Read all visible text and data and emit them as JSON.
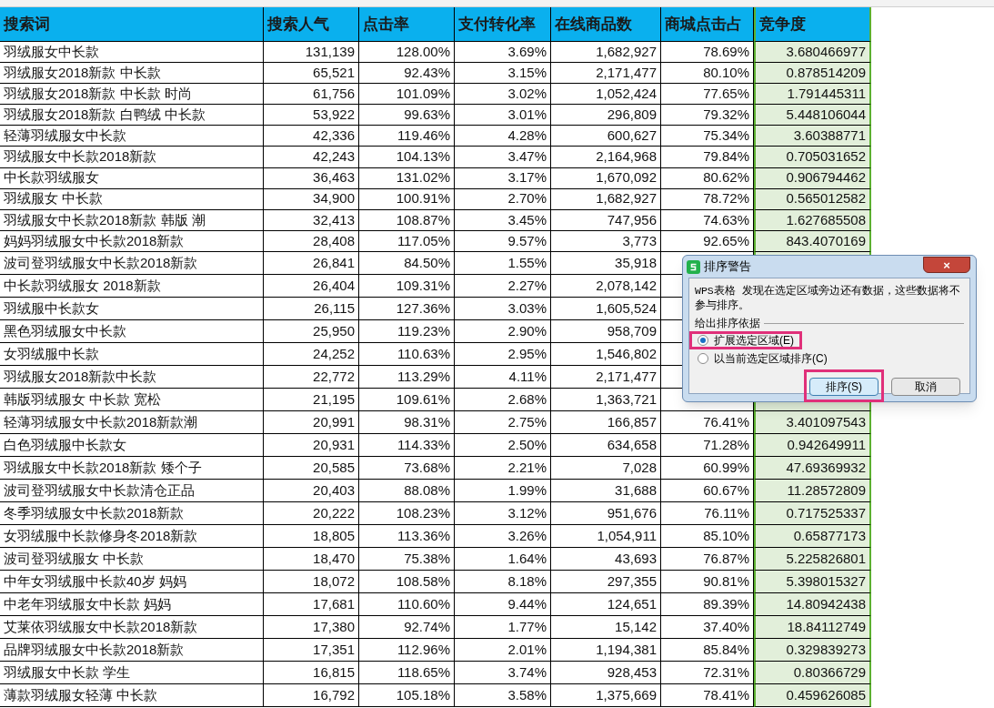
{
  "sheet": {
    "columns": [
      "搜索词",
      "搜索人气",
      "点击率",
      "支付转化率",
      "在线商品数",
      "商城点击占",
      "竞争度"
    ],
    "rows": [
      [
        "羽绒服女中长款",
        "131,139",
        "128.00%",
        "3.69%",
        "1,682,927",
        "78.69%",
        "3.680466977"
      ],
      [
        "羽绒服女2018新款 中长款",
        "65,521",
        "92.43%",
        "3.15%",
        "2,171,477",
        "80.10%",
        "0.878514209"
      ],
      [
        "羽绒服女2018新款 中长款 时尚",
        "61,756",
        "101.09%",
        "3.02%",
        "1,052,424",
        "77.65%",
        "1.791445311"
      ],
      [
        "羽绒服女2018新款 白鸭绒 中长款",
        "53,922",
        "99.63%",
        "3.01%",
        "296,809",
        "79.32%",
        "5.448106044"
      ],
      [
        "轻薄羽绒服女中长款",
        "42,336",
        "119.46%",
        "4.28%",
        "600,627",
        "75.34%",
        "3.60388771"
      ],
      [
        "羽绒服女中长款2018新款",
        "42,243",
        "104.13%",
        "3.47%",
        "2,164,968",
        "79.84%",
        "0.705031652"
      ],
      [
        "中长款羽绒服女",
        "36,463",
        "131.02%",
        "3.17%",
        "1,670,092",
        "80.62%",
        "0.906794462"
      ],
      [
        "羽绒服女 中长款",
        "34,900",
        "100.91%",
        "2.70%",
        "1,682,927",
        "78.72%",
        "0.565012582"
      ],
      [
        "羽绒服女中长款2018新款 韩版 潮",
        "32,413",
        "108.87%",
        "3.45%",
        "747,956",
        "74.63%",
        "1.627685508"
      ],
      [
        "妈妈羽绒服女中长款2018新款",
        "28,408",
        "117.05%",
        "9.57%",
        "3,773",
        "92.65%",
        "843.4070169"
      ],
      [
        "波司登羽绒服女中长款2018新款",
        "26,841",
        "84.50%",
        "1.55%",
        "35,918"
      ],
      [
        "中长款羽绒服女 2018新款",
        "26,404",
        "109.31%",
        "2.27%",
        "2,078,142"
      ],
      [
        "羽绒服中长款女",
        "26,115",
        "127.36%",
        "3.03%",
        "1,605,524"
      ],
      [
        "黑色羽绒服女中长款",
        "25,950",
        "119.23%",
        "2.90%",
        "958,709"
      ],
      [
        "女羽绒服中长款",
        "24,252",
        "110.63%",
        "2.95%",
        "1,546,802"
      ],
      [
        "羽绒服女2018新款中长款",
        "22,772",
        "113.29%",
        "4.11%",
        "2,171,477"
      ],
      [
        "韩版羽绒服女 中长款 宽松",
        "21,195",
        "109.61%",
        "2.68%",
        "1,363,721"
      ],
      [
        "轻薄羽绒服女中长款2018新款潮",
        "20,991",
        "98.31%",
        "2.75%",
        "166,857",
        "76.41%",
        "3.401097543"
      ],
      [
        "白色羽绒服中长款女",
        "20,931",
        "114.33%",
        "2.50%",
        "634,658",
        "71.28%",
        "0.942649911"
      ],
      [
        "羽绒服女中长款2018新款 矮个子",
        "20,585",
        "73.68%",
        "2.21%",
        "7,028",
        "60.99%",
        "47.69369932"
      ],
      [
        "波司登羽绒服女中长款清仓正品",
        "20,403",
        "88.08%",
        "1.99%",
        "31,688",
        "60.67%",
        "11.28572809"
      ],
      [
        "冬季羽绒服女中长款2018新款",
        "20,222",
        "108.23%",
        "3.12%",
        "951,676",
        "76.11%",
        "0.717525337"
      ],
      [
        "女羽绒服中长款修身冬2018新款",
        "18,805",
        "113.36%",
        "3.26%",
        "1,054,911",
        "85.10%",
        "0.65877173"
      ],
      [
        "波司登羽绒服女 中长款",
        "18,470",
        "75.38%",
        "1.64%",
        "43,693",
        "76.87%",
        "5.225826801"
      ],
      [
        "中年女羽绒服中长款40岁 妈妈",
        "18,072",
        "108.58%",
        "8.18%",
        "297,355",
        "90.81%",
        "5.398015327"
      ],
      [
        "中老年羽绒服女中长款 妈妈",
        "17,681",
        "110.60%",
        "9.44%",
        "124,651",
        "89.39%",
        "14.80942438"
      ],
      [
        "艾莱依羽绒服女中长款2018新款",
        "17,380",
        "92.74%",
        "1.77%",
        "15,142",
        "37.40%",
        "18.84112749"
      ],
      [
        "品牌羽绒服女中长款2018新款",
        "17,351",
        "112.96%",
        "2.01%",
        "1,194,381",
        "85.84%",
        "0.329839273"
      ],
      [
        "羽绒服女中长款 学生",
        "16,815",
        "118.65%",
        "3.74%",
        "928,453",
        "72.31%",
        "0.80366729"
      ],
      [
        "薄款羽绒服女轻薄 中长款",
        "16,792",
        "105.18%",
        "3.58%",
        "1,375,669",
        "78.41%",
        "0.459626085"
      ]
    ]
  },
  "dialog": {
    "title": "排序警告",
    "close": "×",
    "message": "WPS表格 发现在选定区域旁边还有数据，这些数据将不参与排序。",
    "group_label": "给出排序依据",
    "options": [
      {
        "label": "扩展选定区域(E)",
        "selected": true,
        "highlighted": true
      },
      {
        "label": "以当前选定区域排序(C)",
        "selected": false,
        "highlighted": false
      }
    ],
    "buttons": [
      {
        "label": "排序(S)",
        "default": true,
        "highlighted": true
      },
      {
        "label": "取消",
        "default": false,
        "highlighted": false
      }
    ]
  }
}
